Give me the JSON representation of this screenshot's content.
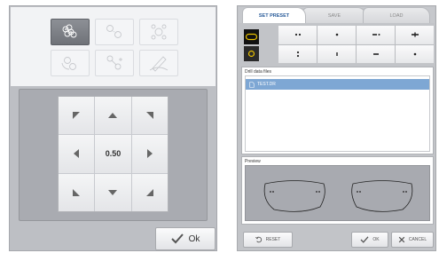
{
  "left": {
    "tools": [
      {
        "icon": "multi-point-icon",
        "active": true
      },
      {
        "icon": "point-offset-icon",
        "active": false
      },
      {
        "icon": "point-cluster-icon",
        "active": false
      },
      {
        "icon": "rotate-point-icon",
        "active": false
      },
      {
        "icon": "point-transform-icon",
        "active": false
      },
      {
        "icon": "pen-draw-icon",
        "active": false
      }
    ],
    "pad": {
      "center_value": "0.50"
    },
    "ok_label": "Ok"
  },
  "right": {
    "tabs": [
      {
        "label": "SET PRESET",
        "active": true
      },
      {
        "label": "SAVE",
        "active": false
      },
      {
        "label": "LOAD",
        "active": false
      }
    ],
    "drill_shapes": [
      "slot-shape-icon",
      "round-hole-icon"
    ],
    "drill_patterns": [
      "double-dot-icon",
      "single-dot-icon",
      "slot-dot-icon",
      "slot-bar-icon",
      "vertical-dots-icon",
      "small-slot-icon",
      "dash-icon",
      "single-dot-icon"
    ],
    "files": {
      "label": "Drill data files",
      "items": [
        "TEST.DR"
      ]
    },
    "preview": {
      "label": "Preview"
    },
    "buttons": {
      "reset": "RESET",
      "ok": "OK",
      "cancel": "CANCEL"
    },
    "colors": {
      "accent": "#2a5c9a",
      "selected_row": "#7ea7d4",
      "shape_selector": "#e9c100"
    }
  }
}
